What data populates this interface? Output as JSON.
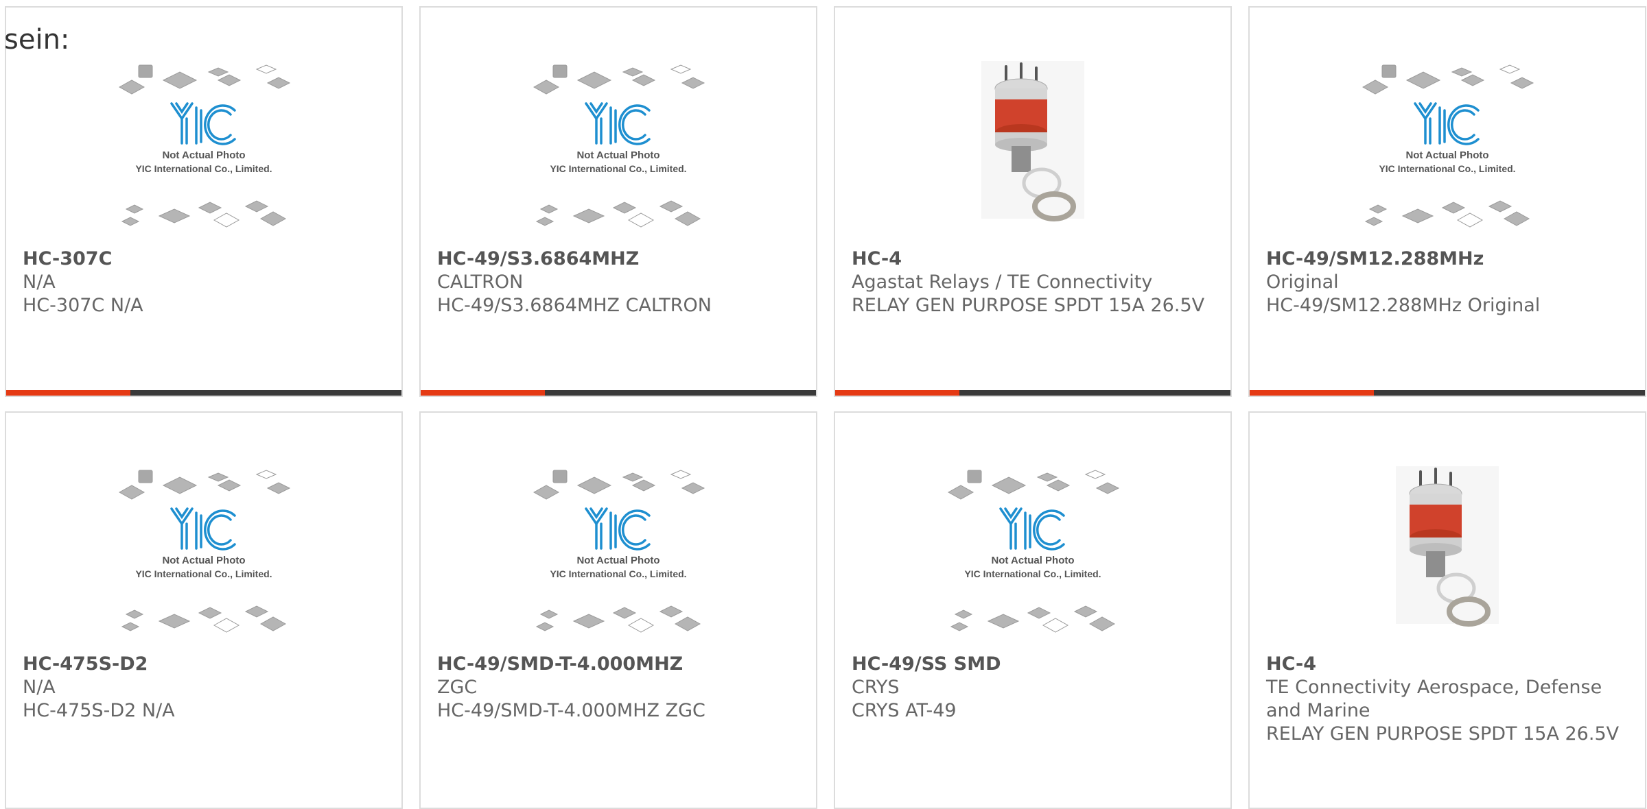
{
  "page": {
    "intro_text": "sein:"
  },
  "placeholder": {
    "caption_line1": "Not Actual Photo",
    "caption_line2": "YIC International Co., Limited.",
    "logo_text": "YIC"
  },
  "colors": {
    "accent": "#e53a14",
    "bar": "#3a3a3a",
    "logo_blue": "#1e8fd0",
    "relay_red": "#d0422c"
  },
  "products": [
    {
      "image": "yic-placeholder-image",
      "part_number": "HC-307C",
      "manufacturer": "N/A",
      "description": "HC-307C N/A"
    },
    {
      "image": "yic-placeholder-image",
      "part_number": "HC-49/S3.6864MHZ",
      "manufacturer": "CALTRON",
      "description": "HC-49/S3.6864MHZ CALTRON"
    },
    {
      "image": "relay-photo",
      "part_number": "HC-4",
      "manufacturer": "Agastat Relays / TE Connectivity",
      "description": "RELAY GEN PURPOSE SPDT 15A 26.5V"
    },
    {
      "image": "yic-placeholder-image",
      "part_number": "HC-49/SM12.288MHz",
      "manufacturer": "Original",
      "description": "HC-49/SM12.288MHz Original"
    },
    {
      "image": "yic-placeholder-image",
      "part_number": "HC-475S-D2",
      "manufacturer": "N/A",
      "description": "HC-475S-D2 N/A"
    },
    {
      "image": "yic-placeholder-image",
      "part_number": "HC-49/SMD-T-4.000MHZ",
      "manufacturer": "ZGC",
      "description": "HC-49/SMD-T-4.000MHZ ZGC"
    },
    {
      "image": "yic-placeholder-image",
      "part_number": "HC-49/SS SMD",
      "manufacturer": "CRYS",
      "description": "CRYS AT-49"
    },
    {
      "image": "relay-photo",
      "part_number": "HC-4",
      "manufacturer": "TE Connectivity Aerospace, Defense and Marine",
      "description": "RELAY GEN PURPOSE SPDT 15A 26.5V"
    }
  ]
}
